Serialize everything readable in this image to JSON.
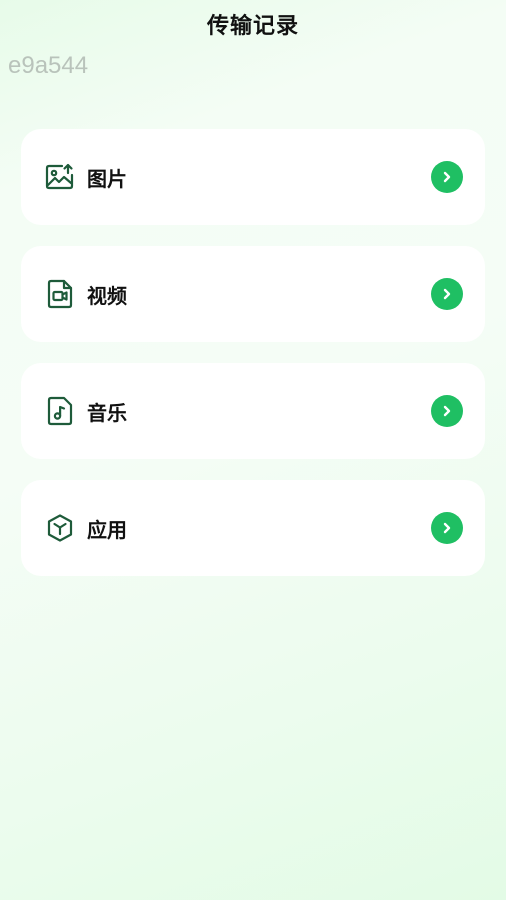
{
  "header": {
    "title": "传输记录"
  },
  "watermark": "e9a544",
  "colors": {
    "accent": "#1fbf63",
    "icon": "#1e5b3a"
  },
  "items": [
    {
      "label": "图片",
      "icon": "image-upload-icon"
    },
    {
      "label": "视频",
      "icon": "video-file-icon"
    },
    {
      "label": "音乐",
      "icon": "music-file-icon"
    },
    {
      "label": "应用",
      "icon": "app-cube-icon"
    }
  ]
}
